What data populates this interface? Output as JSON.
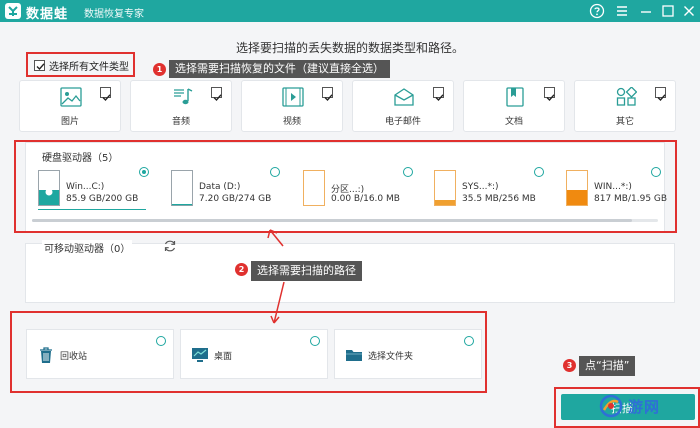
{
  "titlebar": {
    "brand": "数据蛙",
    "subtitle": "数据恢复专家",
    "bg_color": "#1fa7a0"
  },
  "headline": "选择要扫描的丢失数据的数据类型和路径。",
  "select_all": {
    "label": "选择所有文件类型",
    "checked": true
  },
  "callouts": [
    {
      "number": "1",
      "text": "选择需要扫描恢复的文件（建议直接全选）"
    },
    {
      "number": "2",
      "text": "选择需要扫描的路径"
    },
    {
      "number": "3",
      "text": "点“扫描”"
    }
  ],
  "file_types": [
    {
      "label": "图片",
      "icon": "image-icon",
      "checked": true
    },
    {
      "label": "音频",
      "icon": "music-icon",
      "checked": true
    },
    {
      "label": "视频",
      "icon": "video-icon",
      "checked": true
    },
    {
      "label": "电子邮件",
      "icon": "email-icon",
      "checked": true
    },
    {
      "label": "文档",
      "icon": "document-icon",
      "checked": true
    },
    {
      "label": "其它",
      "icon": "other-icon",
      "checked": true
    }
  ],
  "hard_drives": {
    "title": "硬盘驱动器（5）",
    "items": [
      {
        "name": "Win...C:)",
        "size": "85.9 GB/200 GB",
        "selected": true,
        "fill": 0.43,
        "fill_color": "#1fa7a0"
      },
      {
        "name": "Data (D:)",
        "size": "7.20 GB/274 GB",
        "selected": false,
        "fill": 0.03,
        "fill_color": "#1fa7a0"
      },
      {
        "name": "分区...:)",
        "size": "0.00  B/16.0 MB",
        "selected": false,
        "fill": 0.0,
        "fill_color": "#f0a030"
      },
      {
        "name": "SYS...*:)",
        "size": "35.5 MB/256 MB",
        "selected": false,
        "fill": 0.14,
        "fill_color": "#f0a030"
      },
      {
        "name": "WIN...*:)",
        "size": "817 MB/1.95 GB",
        "selected": false,
        "fill": 0.42,
        "fill_color": "#f08a10"
      }
    ]
  },
  "removable": {
    "title": "可移动驱动器（0）",
    "refresh_icon": "refresh-icon"
  },
  "locations": [
    {
      "label": "回收站",
      "icon": "recycle-bin-icon"
    },
    {
      "label": "桌面",
      "icon": "desktop-icon"
    },
    {
      "label": "选择文件夹",
      "icon": "folder-icon"
    }
  ],
  "scan_button": {
    "label": "扫描"
  },
  "watermark": "游网",
  "colors": {
    "accent": "#1fa7a0",
    "highlight_red": "#e0312f",
    "callout_bg": "#555555"
  }
}
